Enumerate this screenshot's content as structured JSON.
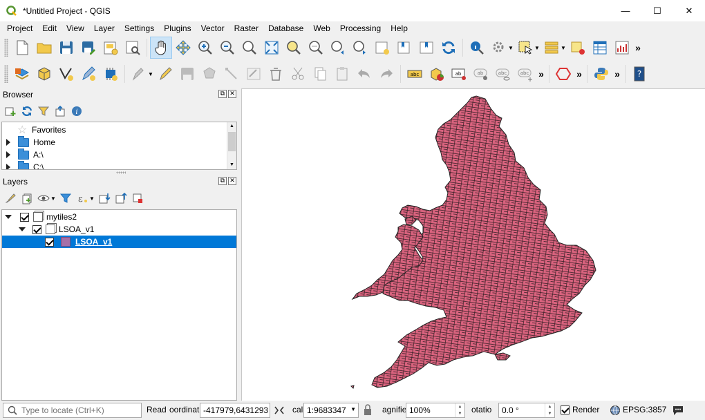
{
  "window": {
    "title": "*Untitled Project - QGIS",
    "minimize": "—",
    "maximize": "☐",
    "close": "✕"
  },
  "menu": [
    "Project",
    "Edit",
    "View",
    "Layer",
    "Settings",
    "Plugins",
    "Vector",
    "Raster",
    "Database",
    "Web",
    "Processing",
    "Help"
  ],
  "toolbar": {
    "more": "»"
  },
  "browser": {
    "title": "Browser",
    "items": [
      "Favorites",
      "Home",
      "A:\\",
      "C:\\"
    ]
  },
  "layers": {
    "title": "Layers",
    "group": "mytiles2",
    "subgroup": "LSOA_v1",
    "layer": "LSOA_v1"
  },
  "status": {
    "locator_placeholder": "Type to locate (Ctrl+K)",
    "ready": "Read",
    "coord_label": "oordinat",
    "coord_value": "-417979,6431293",
    "scale_label": "cal",
    "scale_value": "1:9683347",
    "magnifier_label": "agnifie",
    "magnifier_value": "100%",
    "rotation_label": "otatio",
    "rotation_value": "0.0 °",
    "render_label": "Render",
    "crs": "EPSG:3857"
  },
  "colors": {
    "selection": "#0078d7",
    "layer_fill": "#d9637e",
    "layer_stroke": "#232323"
  }
}
